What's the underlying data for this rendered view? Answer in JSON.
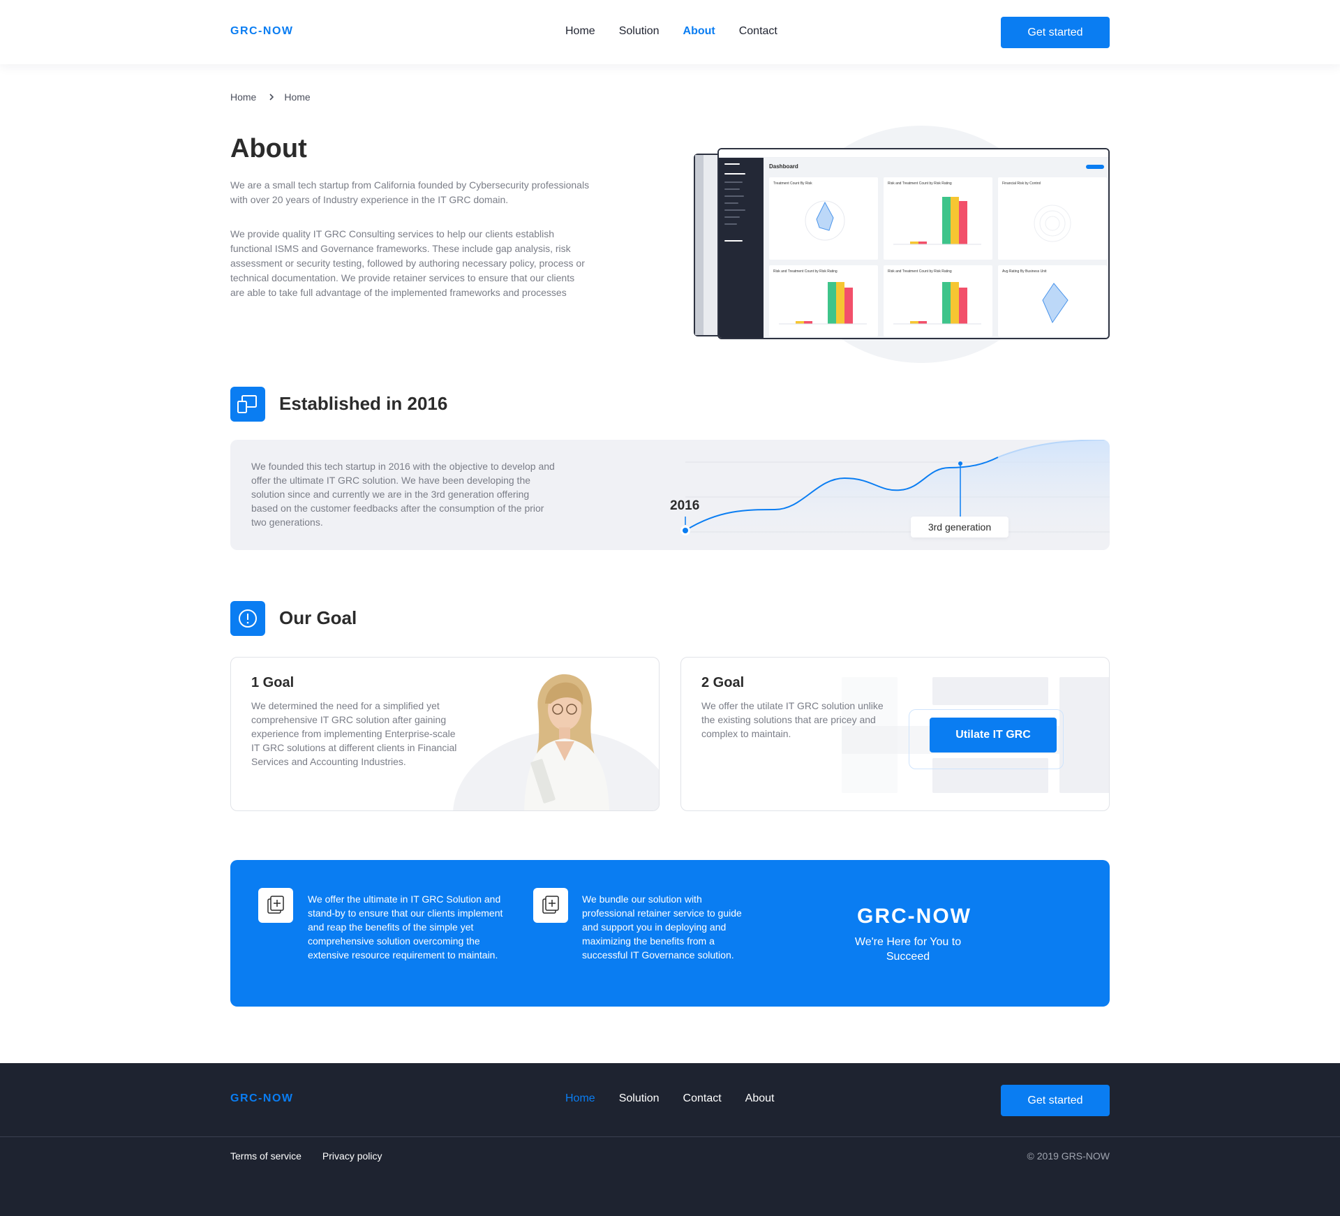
{
  "header": {
    "logo": "GRC-NOW",
    "nav": [
      {
        "label": "Home",
        "active": false
      },
      {
        "label": "Solution",
        "active": false
      },
      {
        "label": "About",
        "active": true
      },
      {
        "label": "Contact",
        "active": false
      }
    ],
    "cta": "Get started"
  },
  "breadcrumb": [
    "Home",
    "Home"
  ],
  "about": {
    "title": "About",
    "p1": "We are a small tech startup from California founded by Cybersecurity professionals with over 20 years of Industry experience in the IT GRC domain.",
    "p2": "We provide quality IT GRC Consulting services to help our clients establish functional ISMS and Governance frameworks. These include gap analysis, risk assessment or security testing, followed by authoring necessary policy, process or technical documentation. We provide retainer services to ensure that our clients are able to take full advantage of the implemented frameworks and processes"
  },
  "dashboard_mock": {
    "title": "Dashboard",
    "cards": [
      "Treatment Count By Risk",
      "Risk and Treatment Count by Risk Rating",
      "Financial Risk by Control",
      "Risk and Treatment Count by Risk Rating",
      "Risk and Treatment Count by Risk Rating",
      "Avg Rating By Business Unit"
    ]
  },
  "established": {
    "title": "Established in 2016",
    "text": "We founded this tech startup in 2016 with the objective to develop and offer the ultimate IT GRC solution. We have been developing the solution since and currently we are in the 3rd generation offering based on the customer feedbacks after the consumption of the prior two generations.",
    "year": "2016",
    "badge": "3rd generation"
  },
  "goal": {
    "title": "Our Goal",
    "goal1": {
      "title": "1 Goal",
      "text": "We determined the need for a simplified yet comprehensive IT GRC solution after gaining experience from implementing Enterprise-scale IT GRC solutions at different clients in Financial Services and Accounting Industries."
    },
    "goal2": {
      "title": "2 Goal",
      "text": "We offer the utilate IT GRC solution unlike the existing solutions that are pricey and complex to maintain.",
      "button": "Utilate IT GRC"
    }
  },
  "banner": {
    "item1": "We offer the ultimate in IT GRC Solution and stand-by to ensure that our clients implement and reap the benefits of the simple yet comprehensive solution overcoming the extensive resource requirement to maintain.",
    "item2": "We bundle our solution with professional retainer service to guide and support you in deploying and maximizing the benefits from a successful IT Governance solution.",
    "logo": "GRC-NOW",
    "tagline": "We're Here for You to Succeed"
  },
  "footer": {
    "logo": "GRC-NOW",
    "nav": [
      {
        "label": "Home",
        "active": true
      },
      {
        "label": "Solution",
        "active": false
      },
      {
        "label": "Contact",
        "active": false
      },
      {
        "label": "About",
        "active": false
      }
    ],
    "cta": "Get started",
    "links": [
      "Terms of service",
      "Privacy policy"
    ],
    "copyright": "© 2019 GRS-NOW"
  },
  "colors": {
    "accent": "#0a7df2",
    "footer_bg": "#1e2330",
    "panel_bg": "#f0f1f5"
  }
}
